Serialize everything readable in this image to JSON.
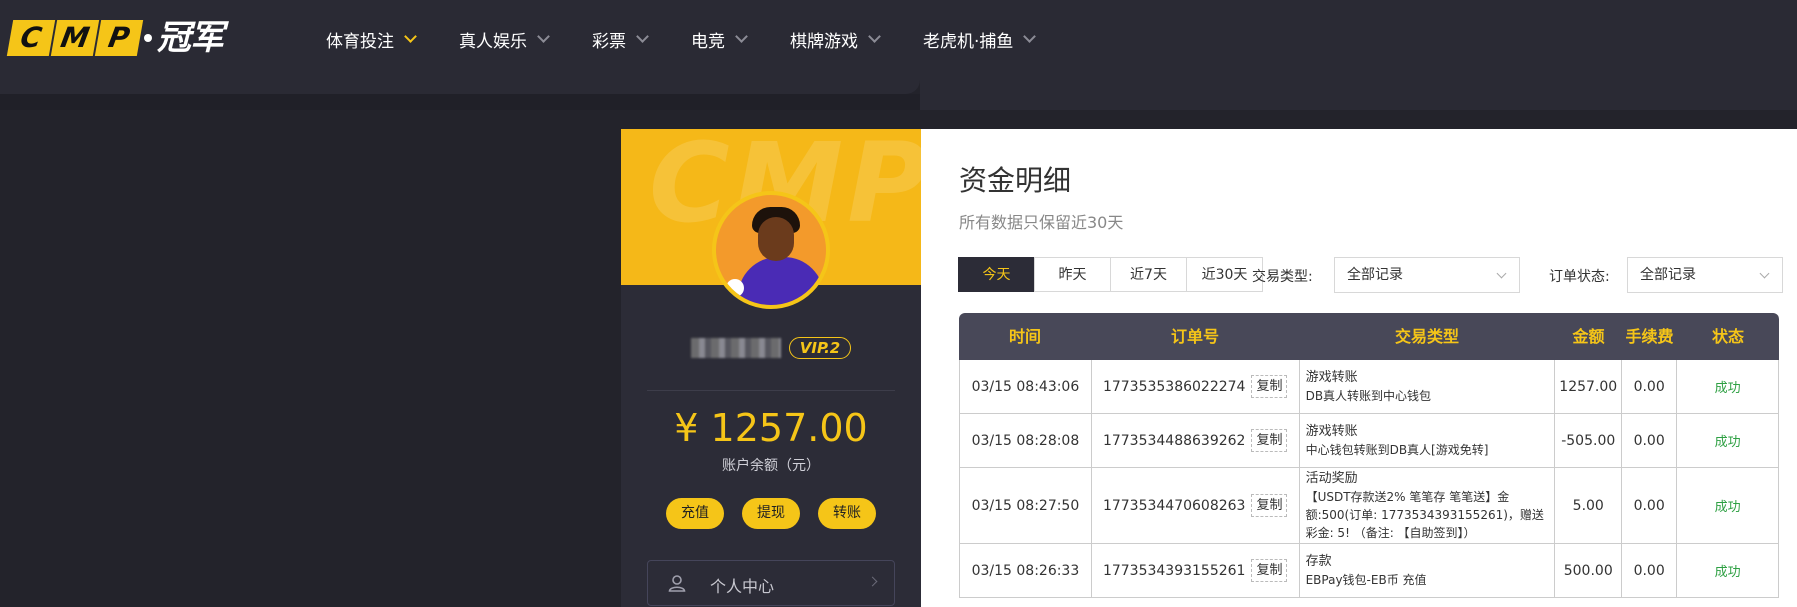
{
  "logo": {
    "letters": [
      "C",
      "M",
      "P"
    ],
    "text": "冠军"
  },
  "nav": [
    {
      "label": "体育投注",
      "active": true
    },
    {
      "label": "真人娱乐"
    },
    {
      "label": "彩票"
    },
    {
      "label": "电竞"
    },
    {
      "label": "棋牌游戏"
    },
    {
      "label": "老虎机·捕鱼"
    }
  ],
  "profile": {
    "vip": "VIP.2",
    "balance": "¥ 1257.00",
    "balance_label": "账户余额（元）",
    "actions": [
      "充值",
      "提现",
      "转账"
    ],
    "menu_item": "个人中心",
    "banner_text": "CMP"
  },
  "main": {
    "title": "资金明细",
    "subtitle": "所有数据只保留近30天",
    "tabs": [
      "今天",
      "昨天",
      "近7天",
      "近30天"
    ],
    "type_label": "交易类型:",
    "type_value": "全部记录",
    "status_label": "订单状态:",
    "status_value": "全部记录",
    "copy_label": "复制",
    "columns": [
      "时间",
      "订单号",
      "交易类型",
      "金额",
      "手续费",
      "状态"
    ],
    "rows": [
      {
        "time": "03/15 08:43:06",
        "order": "1773535386022274",
        "type": "游戏转账",
        "desc": "DB真人转账到中心钱包",
        "amount": "1257.00",
        "fee": "0.00",
        "status": "成功"
      },
      {
        "time": "03/15 08:28:08",
        "order": "1773534488639262",
        "type": "游戏转账",
        "desc": "中心钱包转账到DB真人[游戏免转]",
        "amount": "-505.00",
        "fee": "0.00",
        "status": "成功"
      },
      {
        "time": "03/15 08:27:50",
        "order": "1773534470608263",
        "type": "活动奖励",
        "desc": "【USDT存款送2% 笔笔存 笔笔送】金额:500(订单: 1773534393155261)，赠送彩金: 5! （备注: 【自助签到】）",
        "amount": "5.00",
        "fee": "0.00",
        "status": "成功"
      },
      {
        "time": "03/15 08:26:33",
        "order": "1773534393155261",
        "type": "存款",
        "desc": "EBPay钱包-EB币 充值",
        "amount": "500.00",
        "fee": "0.00",
        "status": "成功"
      }
    ]
  },
  "colors": {
    "accent": "#f5c518",
    "dark": "#2c2c37",
    "success": "#2ea043"
  }
}
